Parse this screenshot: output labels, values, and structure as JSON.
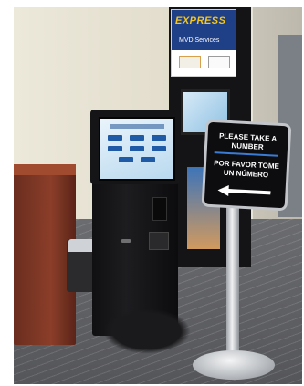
{
  "signs": {
    "express_sign": {
      "brand": "EXPRESS",
      "subtitle": "MVD Services"
    },
    "queue_sign": {
      "english": "PLEASE TAKE A NUMBER",
      "spanish": "POR FAVOR TOME UN NÚMERO",
      "arrow_direction": "left"
    }
  },
  "colors": {
    "express_blue": "#1f3f86",
    "express_yellow": "#f6c71c",
    "kiosk_black": "#151517",
    "podium_wood": "#8b3e29"
  },
  "icons": {
    "arrow": "left-arrow-icon"
  }
}
